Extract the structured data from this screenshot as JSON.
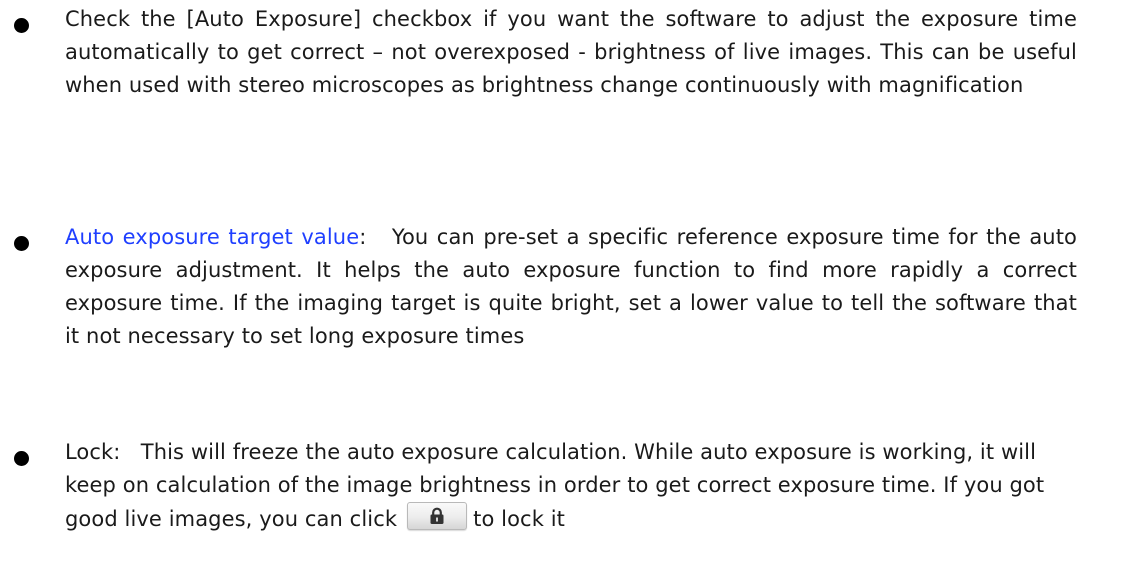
{
  "bullets": [
    {
      "text": "Check the [Auto Exposure] checkbox if you want the software to adjust the exposure time automatically to get correct – not overexposed - brightness of live images. This can be useful when used with stereo microscopes as brightness change continuously with magnification"
    },
    {
      "term": "Auto exposure target value",
      "text": ":   You can pre-set a specific reference exposure time for the auto exposure adjustment. It helps the auto exposure function to find more rapidly a correct exposure time. If the imaging target is quite bright, set a lower value to tell the software that it not necessary to set long exposure times"
    },
    {
      "text_before": "Lock:   This will freeze the auto exposure calculation. While auto exposure is working, it will keep on calculation of the image brightness in order to get correct exposure time. If you got good live images, you can click",
      "button_icon": "lock-icon",
      "text_after": "to lock it"
    }
  ],
  "colors": {
    "term": "#1f3fff",
    "text": "#1a1a1a"
  }
}
